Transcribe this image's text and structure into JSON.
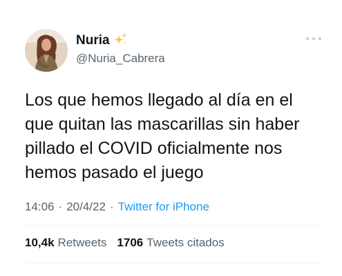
{
  "user": {
    "display_name": "Nuria",
    "handle": "@Nuria_Cabrera",
    "badge_icon": "sparkles-icon"
  },
  "tweet": {
    "text": "Los que hemos llegado al día en el\nque quitan las mascarillas sin haber\npillado el COVID oficialmente nos\nhemos pasado el juego",
    "time": "14:06",
    "date": "20/4/22",
    "source": "Twitter for iPhone",
    "separator": "·"
  },
  "stats": {
    "retweets_count": "10,4k",
    "retweets_label": "Retweets",
    "quotes_count": "1706",
    "quotes_label": "Tweets citados"
  },
  "colors": {
    "link": "#1d9bf0",
    "secondary_text": "#536471",
    "primary_text": "#0f1419"
  }
}
